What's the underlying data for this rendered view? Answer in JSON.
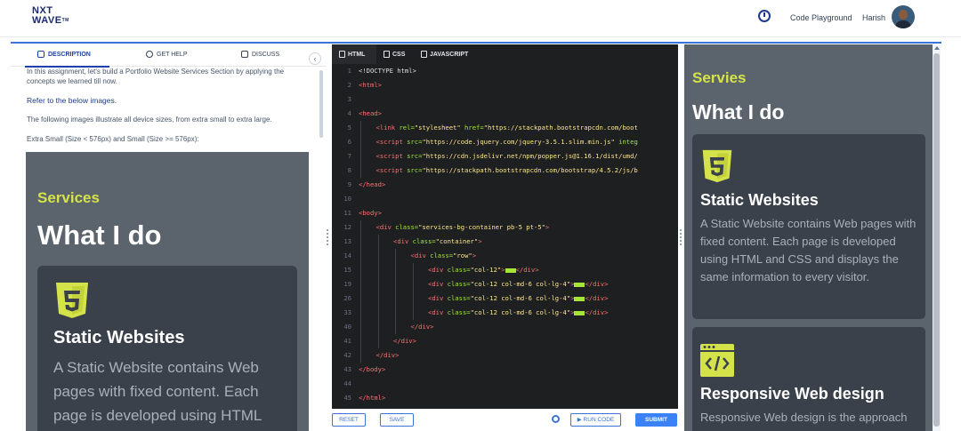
{
  "topbar": {
    "logo_line1": "NXT",
    "logo_line2": "WAVE",
    "logo_tm": "TM",
    "playground_label": "Code Playground",
    "user_name": "Harish"
  },
  "left_panel": {
    "tabs": [
      {
        "label": "DESCRIPTION",
        "icon": "book-icon"
      },
      {
        "label": "GET HELP",
        "icon": "help-icon"
      },
      {
        "label": "DISCUSS",
        "icon": "chat-icon"
      }
    ],
    "collapse_icon": "‹",
    "desc_p1": "In this assignment, let's build a Portfolio Website Services Section by applying the concepts we learned till now.",
    "desc_p2": "Refer to the below images.",
    "desc_p3": "The following images illustrate all device sizes, from extra small to extra large.",
    "desc_p4": "Extra Small (Size < 576px) and Small (Size >= 576px):",
    "preview": {
      "tag": "Services",
      "heading": "What I do",
      "card_title": "Static Websites",
      "card_desc": "A Static Website contains Web pages with fixed content. Each page is developed using HTML"
    }
  },
  "editor": {
    "tabs": [
      {
        "label": "HTML",
        "icon": "html-file-icon"
      },
      {
        "label": "CSS",
        "icon": "css-file-icon"
      },
      {
        "label": "JAVASCRIPT",
        "icon": "js-file-icon"
      }
    ],
    "active_tab": "HTML",
    "lines": [
      {
        "n": "1",
        "indent": 0,
        "parts": [
          [
            "b",
            "<!DOCTYPE html>"
          ]
        ]
      },
      {
        "n": "2",
        "indent": 0,
        "parts": [
          [
            "t",
            "<html>"
          ]
        ]
      },
      {
        "n": "3",
        "indent": 0,
        "parts": []
      },
      {
        "n": "4",
        "indent": 0,
        "parts": [
          [
            "t",
            "<head>"
          ]
        ]
      },
      {
        "n": "5",
        "indent": 1,
        "parts": [
          [
            "t",
            "<link "
          ],
          [
            "a",
            "rel="
          ],
          [
            "s",
            "\"stylesheet\""
          ],
          [
            "a",
            " href="
          ],
          [
            "s",
            "\"https://stackpath.bootstrapcdn.com/boot"
          ]
        ]
      },
      {
        "n": "6",
        "indent": 1,
        "parts": [
          [
            "t",
            "<script "
          ],
          [
            "a",
            "src="
          ],
          [
            "s",
            "\"https://code.jquery.com/jquery-3.5.1.slim.min.js\""
          ],
          [
            "a",
            " integ"
          ]
        ]
      },
      {
        "n": "7",
        "indent": 1,
        "parts": [
          [
            "t",
            "<script "
          ],
          [
            "a",
            "src="
          ],
          [
            "s",
            "\"https://cdn.jsdelivr.net/npm/popper.js@1.16.1/dist/umd/"
          ]
        ]
      },
      {
        "n": "8",
        "indent": 1,
        "parts": [
          [
            "t",
            "<script "
          ],
          [
            "a",
            "src="
          ],
          [
            "s",
            "\"https://stackpath.bootstrapcdn.com/bootstrap/4.5.2/js/b"
          ]
        ]
      },
      {
        "n": "9",
        "indent": 0,
        "parts": [
          [
            "t",
            "</head>"
          ]
        ]
      },
      {
        "n": "10",
        "indent": 0,
        "parts": []
      },
      {
        "n": "11",
        "indent": 0,
        "parts": [
          [
            "t",
            "<body>"
          ]
        ]
      },
      {
        "n": "12",
        "indent": 1,
        "parts": [
          [
            "t",
            "<div "
          ],
          [
            "a",
            "class="
          ],
          [
            "s",
            "\"services-bg-container pb-5 pt-5\""
          ],
          [
            "t",
            ">"
          ]
        ]
      },
      {
        "n": "13",
        "indent": 2,
        "parts": [
          [
            "t",
            "<div "
          ],
          [
            "a",
            "class="
          ],
          [
            "s",
            "\"container\""
          ],
          [
            "t",
            ">"
          ]
        ]
      },
      {
        "n": "14",
        "indent": 3,
        "parts": [
          [
            "t",
            "<div "
          ],
          [
            "a",
            "class="
          ],
          [
            "s",
            "\"row\""
          ],
          [
            "t",
            ">"
          ]
        ]
      },
      {
        "n": "15",
        "indent": 4,
        "parts": [
          [
            "t",
            "<div "
          ],
          [
            "a",
            "class="
          ],
          [
            "s",
            "\"col-12\""
          ],
          [
            "t",
            ">"
          ],
          [
            "hl",
            ""
          ],
          [
            "t",
            "</div>"
          ]
        ]
      },
      {
        "n": "19",
        "indent": 4,
        "parts": [
          [
            "t",
            "<div "
          ],
          [
            "a",
            "class="
          ],
          [
            "s",
            "\"col-12 col-md-6 col-lg-4\""
          ],
          [
            "t",
            ">"
          ],
          [
            "hl",
            ""
          ],
          [
            "t",
            "</div>"
          ]
        ]
      },
      {
        "n": "26",
        "indent": 4,
        "parts": [
          [
            "t",
            "<div "
          ],
          [
            "a",
            "class="
          ],
          [
            "s",
            "\"col-12 col-md-6 col-lg-4\""
          ],
          [
            "t",
            ">"
          ],
          [
            "hl",
            ""
          ],
          [
            "t",
            "</div>"
          ]
        ]
      },
      {
        "n": "33",
        "indent": 4,
        "parts": [
          [
            "t",
            "<div "
          ],
          [
            "a",
            "class="
          ],
          [
            "s",
            "\"col-12 col-md-6 col-lg-4\""
          ],
          [
            "t",
            ">"
          ],
          [
            "hl",
            ""
          ],
          [
            "t",
            "</div>"
          ]
        ]
      },
      {
        "n": "40",
        "indent": 3,
        "parts": [
          [
            "t",
            "</div>"
          ]
        ]
      },
      {
        "n": "41",
        "indent": 2,
        "parts": [
          [
            "t",
            "</div>"
          ]
        ]
      },
      {
        "n": "42",
        "indent": 1,
        "parts": [
          [
            "t",
            "</div>"
          ]
        ]
      },
      {
        "n": "43",
        "indent": 0,
        "parts": [
          [
            "t",
            "</body>"
          ]
        ]
      },
      {
        "n": "44",
        "indent": 0,
        "parts": []
      },
      {
        "n": "45",
        "indent": 0,
        "parts": [
          [
            "t",
            "</html>"
          ]
        ]
      }
    ],
    "buttons": {
      "reset": "RESET",
      "save": "SAVE",
      "run": "▶ RUN CODE",
      "submit": "SUBMIT"
    }
  },
  "output": {
    "tag": "Servies",
    "heading": "What I do",
    "cards": [
      {
        "icon": "html5-icon",
        "title": "Static Websites",
        "desc": "A Static Website contains Web pages with fixed content. Each page is developed using HTML and CSS and displays the same information to every visitor."
      },
      {
        "icon": "code-window-icon",
        "title": "Responsive Web design",
        "desc": "Responsive Web design is the approach"
      }
    ]
  },
  "colors": {
    "accent": "#3b74d8",
    "brand_yellow": "#d4e34a",
    "editor_bg": "#1d1f21",
    "preview_bg": "#5b636d",
    "card_bg": "#3a414b"
  }
}
